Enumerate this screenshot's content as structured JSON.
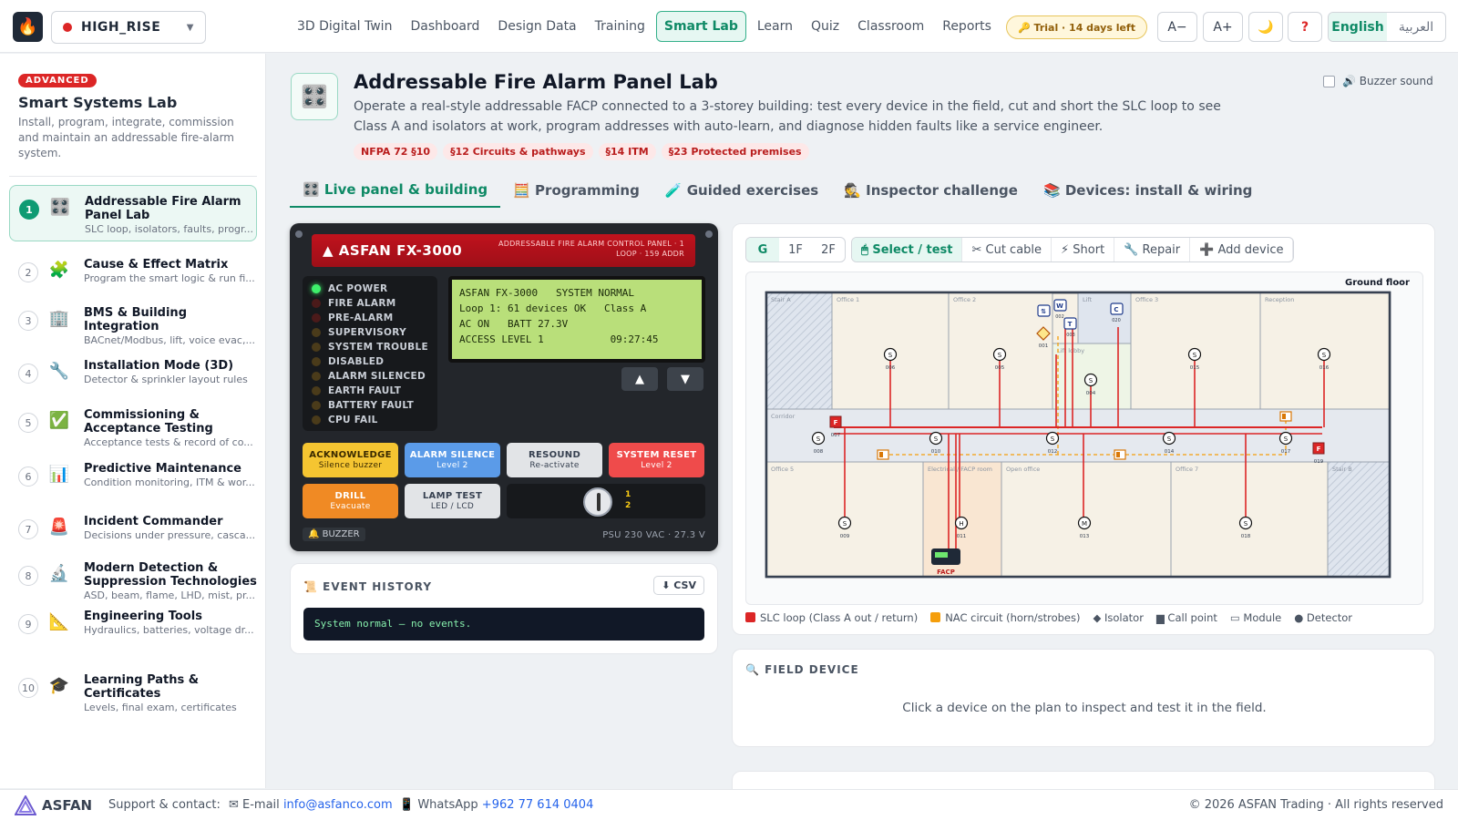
{
  "app": {
    "logo": "fire-icon"
  },
  "project": {
    "name": "HIGH_RISE"
  },
  "nav": [
    "3D Digital Twin",
    "Dashboard",
    "Design Data",
    "Training",
    "Smart Lab",
    "Learn",
    "Quiz",
    "Classroom",
    "Reports"
  ],
  "nav_active": "Smart Lab",
  "trial": "🔑 Trial · 14 days left",
  "font_small": "A−",
  "font_large": "A+",
  "theme_icon": "🌙",
  "help_icon": "?",
  "lang": {
    "en": "English",
    "ar": "العربية"
  },
  "sidebar": {
    "badge": "ADVANCED",
    "title": "Smart Systems Lab",
    "desc": "Install, program, integrate, commission and maintain an addressable fire-alarm system.",
    "modules": [
      {
        "n": "1",
        "icon": "🎛️",
        "title": "Addressable Fire Alarm Panel Lab",
        "sub": "SLC loop, isolators, faults, progr..."
      },
      {
        "n": "2",
        "icon": "🧩",
        "title": "Cause & Effect Matrix",
        "sub": "Program the smart logic & run fi..."
      },
      {
        "n": "3",
        "icon": "🏢",
        "title": "BMS & Building Integration",
        "sub": "BACnet/Modbus, lift, voice evac,..."
      },
      {
        "n": "4",
        "icon": "🔧",
        "title": "Installation Mode (3D)",
        "sub": "Detector & sprinkler layout rules"
      },
      {
        "n": "5",
        "icon": "✅",
        "title": "Commissioning & Acceptance Testing",
        "sub": "Acceptance tests & record of co..."
      },
      {
        "n": "6",
        "icon": "📊",
        "title": "Predictive Maintenance",
        "sub": "Condition monitoring, ITM & wor..."
      },
      {
        "n": "7",
        "icon": "🚨",
        "title": "Incident Commander",
        "sub": "Decisions under pressure, casca..."
      },
      {
        "n": "8",
        "icon": "🔬",
        "title": "Modern Detection & Suppression Technologies",
        "sub": "ASD, beam, flame, LHD, mist, pr..."
      },
      {
        "n": "9",
        "icon": "📐",
        "title": "Engineering Tools",
        "sub": "Hydraulics, batteries, voltage dr..."
      },
      {
        "n": "10",
        "icon": "🎓",
        "title": "Learning Paths & Certificates",
        "sub": "Levels, final exam, certificates"
      }
    ]
  },
  "header": {
    "icon": "🎛️",
    "title": "Addressable Fire Alarm Panel Lab",
    "desc": "Operate a real-style addressable FACP connected to a 3-storey building: test every device in the field, cut and short the SLC loop to see Class A and isolators at work, program addresses with auto-learn, and diagnose hidden faults like a service engineer.",
    "tags": [
      "NFPA 72 §10",
      "§12 Circuits & pathways",
      "§14 ITM",
      "§23 Protected premises"
    ],
    "buzzer": "🔊 Buzzer sound"
  },
  "tabs": [
    "🎛️ Live panel & building",
    "🧮 Programming",
    "🧪 Guided exercises",
    "🕵️ Inspector challenge",
    "📚 Devices: install & wiring"
  ],
  "panel": {
    "name": "▲ ASFAN FX-3000",
    "sub1": "ADDRESSABLE FIRE ALARM CONTROL PANEL · 1",
    "sub2": "LOOP · 159 ADDR",
    "leds": [
      {
        "label": "AC POWER",
        "state": "on"
      },
      {
        "label": "FIRE ALARM",
        "state": "off-red"
      },
      {
        "label": "PRE-ALARM",
        "state": "off-red"
      },
      {
        "label": "SUPERVISORY",
        "state": "off"
      },
      {
        "label": "SYSTEM TROUBLE",
        "state": "off"
      },
      {
        "label": "DISABLED",
        "state": "off"
      },
      {
        "label": "ALARM SILENCED",
        "state": "off"
      },
      {
        "label": "EARTH FAULT",
        "state": "off"
      },
      {
        "label": "BATTERY FAULT",
        "state": "off"
      },
      {
        "label": "CPU FAIL",
        "state": "off"
      }
    ],
    "lcd": [
      "ASFAN FX-3000   SYSTEM NORMAL",
      "Loop 1: 61 devices OK   Class A",
      "AC ON   BATT 27.3V",
      "ACCESS LEVEL 1           09:27:45"
    ],
    "up": "▲",
    "down": "▼",
    "buttons": [
      {
        "label": "ACKNOWLEDGE",
        "sub": "Silence buzzer",
        "bg": "#f5c531",
        "fg": "#3a2a00"
      },
      {
        "label": "ALARM SILENCE",
        "sub": "Level 2",
        "bg": "#5b9be8",
        "fg": "#ffffff"
      },
      {
        "label": "RESOUND",
        "sub": "Re-activate",
        "bg": "#e2e4e7",
        "fg": "#374151"
      },
      {
        "label": "SYSTEM RESET",
        "sub": "Level 2",
        "bg": "#ef4b4b",
        "fg": "#ffffff"
      },
      {
        "label": "DRILL",
        "sub": "Evacuate",
        "bg": "#f08a24",
        "fg": "#ffffff"
      },
      {
        "label": "LAMP TEST",
        "sub": "LED / LCD",
        "bg": "#e2e4e7",
        "fg": "#374151"
      }
    ],
    "key": [
      "1",
      "2"
    ],
    "buzzer": "🔔 BUZZER",
    "psu": "PSU 230 VAC · 27.3 V"
  },
  "events": {
    "title": "📜 EVENT HISTORY",
    "csv": "⬇ CSV",
    "log": "System normal — no events."
  },
  "plan": {
    "floors": [
      "G",
      "1F",
      "2F"
    ],
    "tools": [
      "🖱 Select / test",
      "✂ Cut cable",
      "⚡ Short",
      "🔧 Repair",
      "➕ Add device"
    ],
    "floor_title": "Ground floor",
    "rooms": [
      "Stair A",
      "Office 1",
      "Office 2",
      "Lift",
      "Office 3",
      "Reception",
      "Lift lobby",
      "Corridor",
      "Office 5",
      "Electrical / FACP room",
      "Open office",
      "Office 7",
      "Stair B"
    ],
    "devices": [
      "006",
      "005",
      "015",
      "016",
      "004",
      "008",
      "007",
      "010",
      "012",
      "014",
      "017",
      "019",
      "009",
      "011",
      "013",
      "018",
      "001",
      "002",
      "003",
      "020"
    ],
    "facp": "FACP",
    "legend": [
      {
        "label": "SLC loop (Class A out / return)",
        "color": "#dc2626"
      },
      {
        "label": "NAC circuit (horn/strobes)",
        "color": "#f59e0b"
      },
      {
        "label": "◆ Isolator"
      },
      {
        "label": "▆ Call point"
      },
      {
        "label": "▭ Module"
      },
      {
        "label": "● Detector"
      }
    ]
  },
  "field": {
    "title": "🔍 FIELD DEVICE",
    "msg": "Click a device on the plan to inspect and test it in the field."
  },
  "footer": {
    "brand": "ASFAN",
    "support": "Support & contact:",
    "email_label": "✉ E-mail",
    "email": "info@asfanco.com",
    "wa_label": "📱 WhatsApp",
    "wa": "+962 77 614 0404",
    "copy": "© 2026 ASFAN Trading · All rights reserved"
  }
}
